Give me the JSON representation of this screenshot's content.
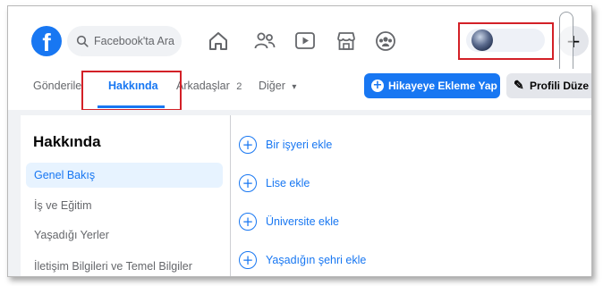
{
  "header": {
    "logo_letter": "f",
    "search_placeholder": "Facebook'ta Ara",
    "nav_icons": [
      "home-icon",
      "friends-icon",
      "watch-video-icon",
      "marketplace-icon",
      "groups-icon"
    ],
    "create_symbol": "+"
  },
  "tabs": {
    "items": [
      {
        "label": "Gönderile"
      },
      {
        "label": "Hakkında"
      },
      {
        "label": "Arkadaşlar"
      },
      {
        "label": "Diğer"
      }
    ],
    "friends_count": "2",
    "more_caret": "▾",
    "active_index": 1,
    "story_button": {
      "symbol": "+",
      "label": "Hikayeye Ekleme Yap"
    },
    "edit_button": {
      "symbol": "✎",
      "label": "Profili Düze"
    }
  },
  "about": {
    "title": "Hakkında",
    "sidebar": [
      {
        "label": "Genel Bakış"
      },
      {
        "label": "İş ve Eğitim"
      },
      {
        "label": "Yaşadığı Yerler"
      },
      {
        "label": "İletişim Bilgileri ve Temel Bilgiler"
      }
    ],
    "active_index": 0,
    "add_items": [
      {
        "symbol": "+",
        "label": "Bir işyeri ekle"
      },
      {
        "symbol": "+",
        "label": "Lise ekle"
      },
      {
        "symbol": "+",
        "label": "Üniversite ekle"
      },
      {
        "symbol": "+",
        "label": "Yaşadığın şehri ekle"
      }
    ]
  },
  "colors": {
    "brand": "#1877f2",
    "highlight": "#d32027",
    "background": "#f0f2f5"
  }
}
